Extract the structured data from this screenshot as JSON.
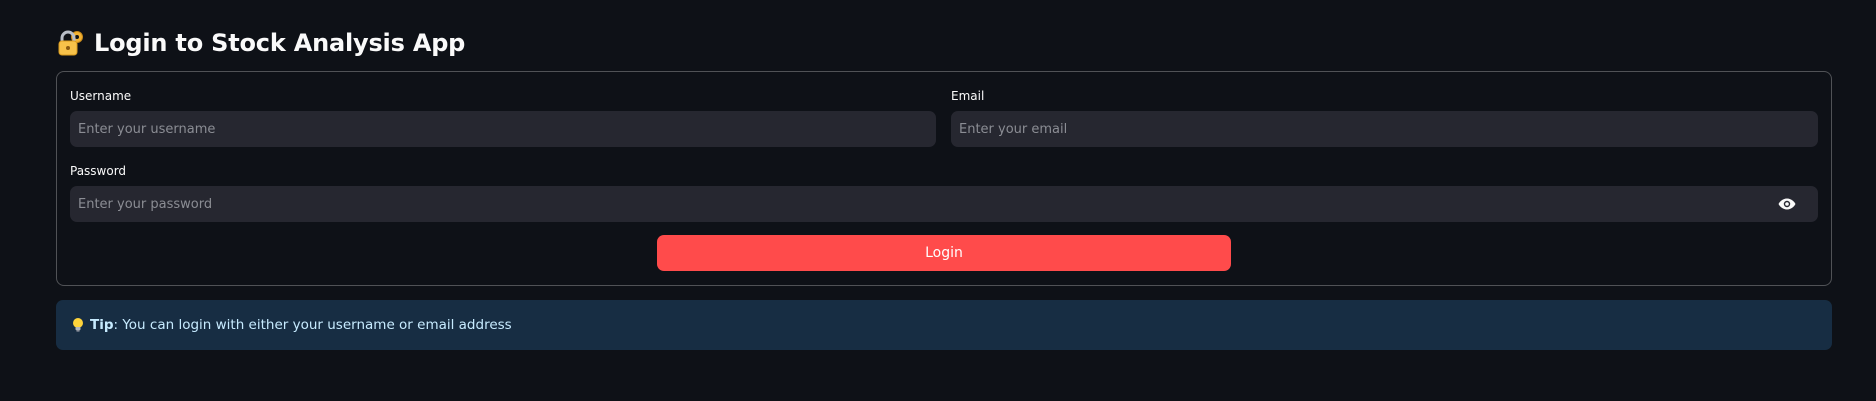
{
  "page": {
    "title": "Login to Stock Analysis App"
  },
  "form": {
    "username": {
      "label": "Username",
      "placeholder": "Enter your username",
      "value": ""
    },
    "email": {
      "label": "Email",
      "placeholder": "Enter your email",
      "value": ""
    },
    "password": {
      "label": "Password",
      "placeholder": "Enter your password",
      "value": ""
    },
    "login_label": "Login"
  },
  "tip": {
    "strong": "Tip",
    "text": ": You can login with either your username or email address"
  },
  "icons": {
    "title_icon": "locked-with-key-icon",
    "password_toggle": "eye-icon",
    "tip_icon": "light-bulb-icon"
  },
  "colors": {
    "background": "#0e1117",
    "input_background": "#262730",
    "primary_button": "#ff4b4b",
    "tip_background": "#172d43",
    "tip_text": "#c7ebff"
  }
}
